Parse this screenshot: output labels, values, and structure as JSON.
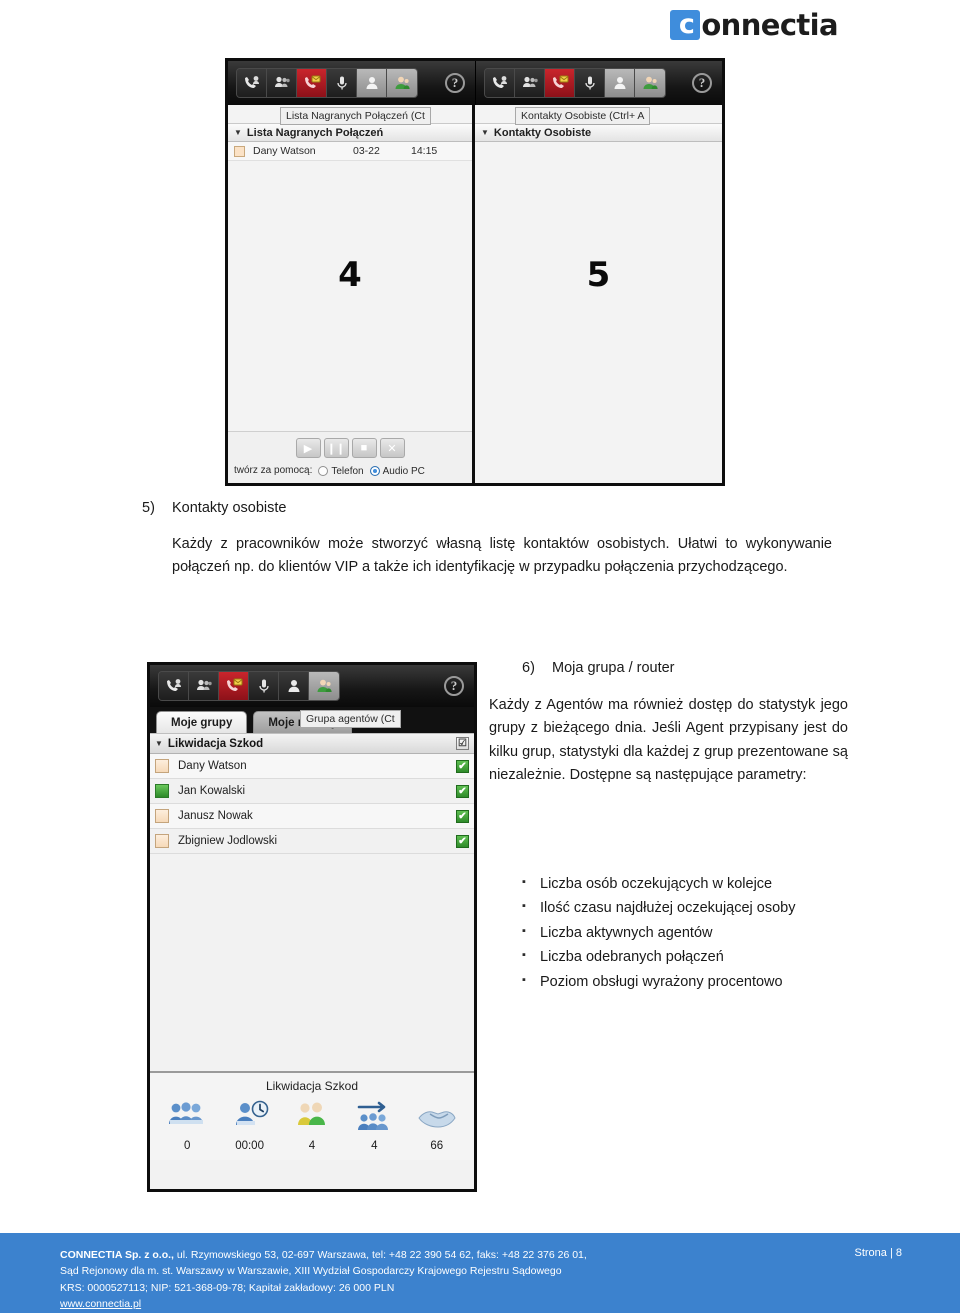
{
  "brand": {
    "logo_mark_letter": "c",
    "logo_text": "onnectia",
    "logo_color": "#3f8ddc"
  },
  "screenshot_top": {
    "callout_left": "4",
    "callout_right": "5",
    "toolbar_icons": [
      "incoming-call-icon",
      "group-call-icon",
      "voicemail-icon",
      "microphone-icon",
      "contact-icon",
      "agent-icon"
    ],
    "help_label": "?",
    "left_pane": {
      "tooltip": "Lista Nagranych Połączeń (Ct",
      "header": "Lista Nagranych Połączeń",
      "rows": [
        {
          "name": "Dany Watson",
          "date": "03-22",
          "time": "14:15"
        }
      ]
    },
    "right_pane": {
      "tooltip": "Kontakty Osobiste (Ctrl+ A",
      "header": "Kontakty Osobiste"
    },
    "media": {
      "buttons": [
        "play-button",
        "pause-button",
        "stop-button",
        "close-button"
      ],
      "glyphs": [
        "▶",
        "❙❙",
        "■",
        "✕"
      ],
      "label": "twórz za pomocą:",
      "options": [
        {
          "label": "Telefon",
          "selected": false
        },
        {
          "label": "Audio PC",
          "selected": true
        }
      ]
    }
  },
  "section5": {
    "number": "5)",
    "title": "Kontakty osobiste",
    "paragraph": "Każdy z pracowników może stworzyć własną listę kontaktów osobistych. Ułatwi to wykonywanie połączeń np. do klientów VIP a także ich identyfikację w przypadku połączenia przychodzącego."
  },
  "screenshot_bottom": {
    "toolbar_icons": [
      "incoming-call-icon",
      "group-call-icon",
      "voicemail-icon",
      "microphone-icon",
      "contact-icon",
      "agent-icon"
    ],
    "help_label": "?",
    "tooltip": "Grupa agentów (Ct",
    "tabs": [
      {
        "label": "Moje grupy",
        "active": true
      },
      {
        "label": "Moje routery",
        "active": false
      }
    ],
    "group_header": "Likwidacja Szkod",
    "group_header_checked": true,
    "agents": [
      {
        "name": "Dany Watson",
        "status": "away",
        "checked": true
      },
      {
        "name": "Jan Kowalski",
        "status": "available",
        "checked": true
      },
      {
        "name": "Janusz Nowak",
        "status": "away",
        "checked": true
      },
      {
        "name": "Zbigniew Jodlowski",
        "status": "away",
        "checked": true
      }
    ],
    "stats": {
      "title": "Likwidacja Szkod",
      "items": [
        {
          "icon": "waiting-queue-icon",
          "value": "0"
        },
        {
          "icon": "longest-wait-time-icon",
          "value": "00:00"
        },
        {
          "icon": "active-agents-icon",
          "value": "4"
        },
        {
          "icon": "answered-calls-icon",
          "value": "4"
        },
        {
          "icon": "service-level-icon",
          "value": "66"
        }
      ]
    }
  },
  "section6": {
    "number": "6)",
    "title": "Moja grupa / router",
    "paragraph": "Każdy z Agentów ma również dostęp do statystyk jego grupy z bieżącego dnia. Jeśli Agent przypisany jest do kilku grup, statystyki dla każdej z grup prezentowane są niezależnie. Dostępne są następujące parametry:",
    "bullet_marker": "▪",
    "bullets": [
      "Liczba osób oczekujących w kolejce",
      "Ilość czasu najdłużej oczekującej osoby",
      "Liczba aktywnych agentów",
      "Liczba odebranych połączeń",
      "Poziom obsługi wyrażony procentowo"
    ]
  },
  "footer": {
    "background_color": "#3c82ce",
    "line1_bold": "CONNECTIA Sp. z o.o.,",
    "line1_rest": " ul. Rzymowskiego 53, 02-697 Warszawa, tel: +48 22 390 54 62, faks: +48 22 376 26 01,",
    "line2": "Sąd Rejonowy dla m. st. Warszawy w Warszawie, XIII Wydział Gospodarczy Krajowego Rejestru Sądowego",
    "line3": "KRS: 0000527113; NIP: 521-368-09-78; Kapitał zakładowy: 26 000 PLN",
    "link": "www.connectia.pl",
    "page_label": "Strona | 8"
  }
}
